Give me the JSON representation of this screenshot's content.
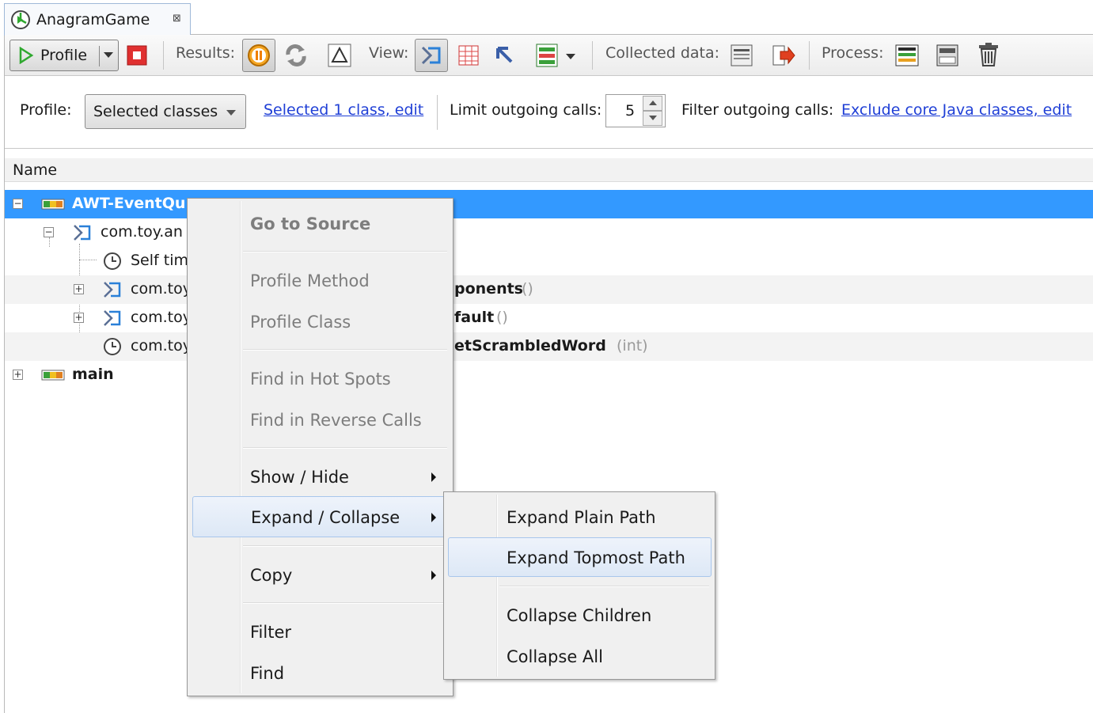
{
  "tab": {
    "title": "AnagramGame",
    "close_glyph": "⊠"
  },
  "toolbar": {
    "profile_label": "Profile",
    "results_label": "Results:",
    "view_label": "View:",
    "collected_label": "Collected data:",
    "process_label": "Process:"
  },
  "options": {
    "profile_label": "Profile:",
    "profile_value": "Selected classes",
    "selected_link": "Selected 1 class, edit",
    "limit_label": "Limit outgoing calls:",
    "limit_value": "5",
    "filter_label": "Filter outgoing calls:",
    "filter_link": "Exclude core Java classes, edit"
  },
  "table": {
    "column_name": "Name",
    "rows": [
      {
        "label": "AWT-EventQu"
      },
      {
        "label": "com.toy.an"
      },
      {
        "label": "Self tim"
      },
      {
        "label": "com.toy",
        "tail_bold": "ponents",
        "tail_args": " ()"
      },
      {
        "label": "com.toy",
        "tail_bold": "fault",
        "tail_args": " ()"
      },
      {
        "label": "com.toy",
        "tail_bold": "etScrambledWord",
        "tail_args": " (int)"
      },
      {
        "label": "main"
      }
    ]
  },
  "context_menu": {
    "items": [
      {
        "label": "Go to Source"
      },
      {
        "label": "Profile Method"
      },
      {
        "label": "Profile Class"
      },
      {
        "label": "Find in Hot Spots"
      },
      {
        "label": "Find in Reverse Calls"
      },
      {
        "label": "Show / Hide"
      },
      {
        "label": "Expand / Collapse"
      },
      {
        "label": "Copy"
      },
      {
        "label": "Filter"
      },
      {
        "label": "Find"
      }
    ]
  },
  "submenu": {
    "items": [
      {
        "label": "Expand Plain Path"
      },
      {
        "label": "Expand Topmost Path"
      },
      {
        "label": "Collapse Children"
      },
      {
        "label": "Collapse All"
      }
    ]
  },
  "colors": {
    "selection": "#3399ff",
    "link": "#1f3fd6",
    "stop": "#e03030",
    "play": "#2fa82f"
  }
}
